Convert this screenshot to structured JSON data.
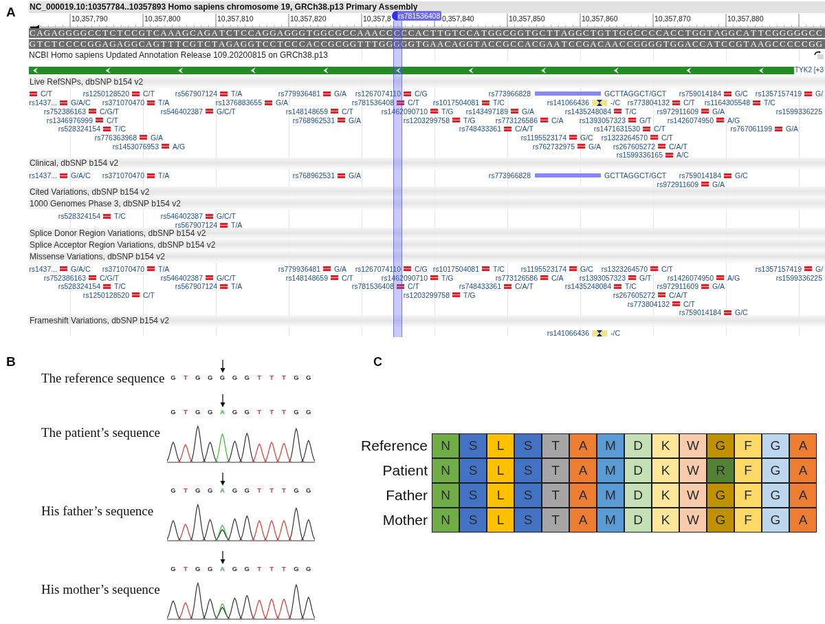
{
  "panel_a": {
    "panel_label": "A",
    "title": "NC_000019.10:10357784..10357893 Homo sapiens chromosome 19, GRCh38.p13 Primary Assembly",
    "ruler": {
      "ticks": [
        "10,357,790",
        "10,357,800",
        "10,357,810",
        "10,357,820",
        "10,357,8",
        "0,357,840",
        "10,357,850",
        "10,357,860",
        "10,357,870",
        "10,357,880"
      ]
    },
    "selection": {
      "label": "rs781536408"
    },
    "sequence": {
      "forward": "CAGAGGGGCCTCTCCGTCAAAGCAGATCTCCAGGAGGGTGGCGCCAAACCCCCACTTGTCCATGGCGGTGCTTAGGCTGTTGGCCCCACCTGGTAGGCATTCGGGGGCC",
      "reverse": "GTCTCCCCGGAGAGGCAGTTTCGTCTAGAGGTCCTCCCACCGCGGTTTGGGGGTGAACAGGTACCGCCACGAATCCGACAACCGGGGTGGACCATCCGTAAGCCCCCGG"
    },
    "annotation_release": "NCBI Homo sapiens Updated Annotation Release 109.20200815 on GRCh38.p13",
    "gene": {
      "label": "TYK2 [+3",
      "reverse_strand": true
    },
    "tracks": [
      {
        "title": "Live RefSNPs, dbSNP b154 v2",
        "rows": [
          {
            "variants": [
              {
                "kind": "snv",
                "allele": "C/T"
              },
              {
                "name": "rs1250128520",
                "kind": "snv",
                "allele": "C/T"
              },
              {
                "name": "rs567907124",
                "kind": "snv",
                "allele": "T/A"
              },
              {
                "name": "rs779936481",
                "kind": "snv",
                "allele": "G/A"
              },
              {
                "name": "rs1267074110",
                "kind": "snv",
                "allele": "C/G"
              },
              {
                "name": "rs773966828",
                "kind": "mnv",
                "allele": "GCTTAGGCT/GCT"
              },
              {
                "name": "rs759014184",
                "kind": "snv",
                "allele": "G/C"
              },
              {
                "name": "rs1357157419",
                "kind": "snv",
                "allele": "G/"
              }
            ]
          },
          {
            "variants": [
              {
                "name": "rs1437...",
                "kind": "snv",
                "allele": "G/A/C"
              },
              {
                "name": "rs371070470",
                "kind": "snv",
                "allele": "T/A"
              },
              {
                "name": "rs1376883655",
                "kind": "snv",
                "allele": "G/A"
              },
              {
                "name": "rs781536408",
                "kind": "snv",
                "allele": "C/T"
              },
              {
                "name": "rs1017504081",
                "kind": "snv",
                "allele": "T/C"
              },
              {
                "name": "rs141066436",
                "kind": "insertion",
                "allele": "-/C"
              },
              {
                "name": "rs773804132",
                "kind": "snv",
                "allele": "C/T"
              },
              {
                "name": "rs1164305548",
                "kind": "snv",
                "allele": "T/C"
              }
            ]
          },
          {
            "variants": [
              {
                "name": "rs752386163",
                "kind": "snv",
                "allele": "C/G/T"
              },
              {
                "name": "rs546402387",
                "kind": "snv",
                "allele": "G/C/T"
              },
              {
                "name": "rs148148659",
                "kind": "snv",
                "allele": "C/T"
              },
              {
                "name": "rs1462090710",
                "kind": "snv",
                "allele": "T/G"
              },
              {
                "name": "rs143497189",
                "kind": "snv",
                "allele": "G/A"
              },
              {
                "name": "rs1435248084",
                "kind": "snv",
                "allele": "T/C"
              },
              {
                "name": "rs972911609",
                "kind": "snv",
                "allele": "G/A"
              },
              {
                "name": "rs1599336225"
              }
            ]
          },
          {
            "variants": [
              {
                "name": "rs1346976999",
                "kind": "snv",
                "allele": "C/T"
              },
              {
                "name": "rs768962531",
                "kind": "snv",
                "allele": "G/A"
              },
              {
                "name": "rs1203299758",
                "kind": "snv",
                "allele": "T/G"
              },
              {
                "name": "rs773126586",
                "kind": "snv",
                "allele": "C/A"
              },
              {
                "name": "rs1393057323",
                "kind": "snv",
                "allele": "G/T"
              },
              {
                "name": "rs1426074950",
                "kind": "snv",
                "allele": "A/G"
              }
            ]
          },
          {
            "variants": [
              {
                "name": "rs528324154",
                "kind": "snv",
                "allele": "T/C"
              },
              {
                "name": "rs748433361",
                "kind": "snv",
                "allele": "C/A/T"
              },
              {
                "name": "rs1471631530",
                "kind": "snv",
                "allele": "C/T"
              },
              {
                "name": "rs767061199",
                "kind": "snv",
                "allele": "G/A"
              }
            ]
          },
          {
            "variants": [
              {
                "name": "rs776363968",
                "kind": "snv",
                "allele": "G/A"
              },
              {
                "name": "rs1195523174",
                "kind": "snv",
                "allele": "G/C"
              },
              {
                "name": "rs1323264570",
                "kind": "snv",
                "allele": "C/T"
              }
            ]
          },
          {
            "variants": [
              {
                "name": "rs1453076953",
                "kind": "snv",
                "allele": "A/G"
              },
              {
                "name": "rs762732975",
                "kind": "snv",
                "allele": "G/A"
              },
              {
                "name": "rs267605272",
                "kind": "snv",
                "allele": "C/A/T"
              }
            ]
          },
          {
            "variants": [
              {
                "name": "rs1599336165",
                "kind": "snv",
                "allele": "A/C"
              }
            ]
          }
        ]
      },
      {
        "title": "Clinical, dbSNP b154 v2",
        "rows": [
          {
            "variants": [
              {
                "name": "rs1437...",
                "kind": "snv",
                "allele": "G/A/C"
              },
              {
                "name": "rs371070470",
                "kind": "snv",
                "allele": "T/A"
              },
              {
                "name": "rs768962531",
                "kind": "snv",
                "allele": "G/A"
              },
              {
                "name": "rs773966828",
                "kind": "mnv",
                "allele": "GCTTAGGCT/GCT"
              },
              {
                "name": "rs759014184",
                "kind": "snv",
                "allele": "G/C"
              }
            ]
          },
          {
            "variants": [
              {
                "name": "rs972911609",
                "kind": "snv",
                "allele": "G/A"
              }
            ]
          }
        ]
      },
      {
        "title": "Cited Variations, dbSNP b154 v2"
      },
      {
        "title": "1000 Genomes Phase 3, dbSNP b154 v2",
        "rows": [
          {
            "variants": [
              {
                "name": "rs528324154",
                "kind": "snv",
                "allele": "T/C"
              },
              {
                "name": "rs546402387",
                "kind": "snv",
                "allele": "G/C/T"
              }
            ]
          },
          {
            "variants": [
              {
                "name": "rs567907124",
                "kind": "snv",
                "allele": "T/A"
              }
            ]
          }
        ]
      },
      {
        "title": "Splice Donor Region Variations, dbSNP b154 v2"
      },
      {
        "title": "Splice Acceptor Region Variations, dbSNP b154 v2"
      },
      {
        "title": "Missense Variations, dbSNP b154 v2",
        "rows": [
          {
            "variants": [
              {
                "name": "rs1437...",
                "kind": "snv",
                "allele": "G/A/C"
              },
              {
                "name": "rs371070470",
                "kind": "snv",
                "allele": "T/A"
              },
              {
                "name": "rs779936481",
                "kind": "snv",
                "allele": "G/A"
              },
              {
                "name": "rs1267074110",
                "kind": "snv",
                "allele": "C/G"
              },
              {
                "name": "rs1017504081",
                "kind": "snv",
                "allele": "T/C"
              },
              {
                "name": "rs1195523174",
                "kind": "snv",
                "allele": "G/C"
              },
              {
                "name": "rs1323264570",
                "kind": "snv",
                "allele": "C/T"
              },
              {
                "name": "rs1357157419",
                "kind": "snv",
                "allele": "G/"
              }
            ]
          },
          {
            "variants": [
              {
                "name": "rs752386163",
                "kind": "snv",
                "allele": "C/G/T"
              },
              {
                "name": "rs546402387",
                "kind": "snv",
                "allele": "G/C/T"
              },
              {
                "name": "rs148148659",
                "kind": "snv",
                "allele": "C/T"
              },
              {
                "name": "rs1462090710",
                "kind": "snv",
                "allele": "T/G"
              },
              {
                "name": "rs773126586",
                "kind": "snv",
                "allele": "C/A"
              },
              {
                "name": "rs1393057323",
                "kind": "snv",
                "allele": "G/T"
              },
              {
                "name": "rs1426074950",
                "kind": "snv",
                "allele": "A/G"
              },
              {
                "name": "rs1599336225"
              }
            ]
          },
          {
            "variants": [
              {
                "name": "rs528324154",
                "kind": "snv",
                "allele": "T/C"
              },
              {
                "name": "rs567907124",
                "kind": "snv",
                "allele": "T/A"
              },
              {
                "name": "rs781536408",
                "kind": "snv",
                "allele": "C/T"
              },
              {
                "name": "rs748433361",
                "kind": "snv",
                "allele": "C/A/T"
              },
              {
                "name": "rs1435248084",
                "kind": "snv",
                "allele": "T/C"
              },
              {
                "name": "rs972911609",
                "kind": "snv",
                "allele": "G/A"
              }
            ]
          },
          {
            "variants": [
              {
                "name": "rs1250128520",
                "kind": "snv",
                "allele": "C/T"
              },
              {
                "name": "rs1203299758",
                "kind": "snv",
                "allele": "T/G"
              },
              {
                "name": "rs267605272",
                "kind": "snv",
                "allele": "C/A/T"
              }
            ]
          },
          {
            "variants": [
              {
                "name": "rs773804132",
                "kind": "snv",
                "allele": "C/T"
              }
            ]
          },
          {
            "variants": [
              {
                "name": "rs759014184",
                "kind": "snv",
                "allele": "G/C"
              }
            ]
          }
        ]
      },
      {
        "title": "Frameshift Variations, dbSNP b154 v2",
        "rows": [
          {
            "variants": [
              {
                "name": "rs141066436",
                "kind": "insertion",
                "allele": "-/C"
              }
            ]
          }
        ]
      }
    ]
  },
  "panel_b": {
    "panel_label": "B",
    "sequences": [
      {
        "label": "The reference sequence",
        "kind": "reference",
        "bases": [
          {
            "base": "G",
            "color": "#333333",
            "marked": false
          },
          {
            "base": "T",
            "color": "#e8322a",
            "marked": false
          },
          {
            "base": "G",
            "color": "#333333",
            "marked": false
          },
          {
            "base": "G",
            "color": "#333333",
            "marked": false
          },
          {
            "base": "G",
            "color": "#333333",
            "marked": true
          },
          {
            "base": "G",
            "color": "#333333",
            "marked": false
          },
          {
            "base": "G",
            "color": "#333333",
            "marked": false
          },
          {
            "base": "T",
            "color": "#e8322a",
            "marked": false
          },
          {
            "base": "T",
            "color": "#e8322a",
            "marked": false
          },
          {
            "base": "T",
            "color": "#e8322a",
            "marked": false
          },
          {
            "base": "G",
            "color": "#333333",
            "marked": false
          },
          {
            "base": "G",
            "color": "#333333",
            "marked": false
          }
        ]
      },
      {
        "label": "The patient’s sequence",
        "kind": "chromatogram",
        "bases": [
          {
            "base": "G",
            "color": "#333333",
            "marked": false
          },
          {
            "base": "T",
            "color": "#e8322a",
            "marked": false
          },
          {
            "base": "G",
            "color": "#333333",
            "marked": false
          },
          {
            "base": "G",
            "color": "#333333",
            "marked": false
          },
          {
            "base": "A",
            "color": "#2fbf2f",
            "marked": true
          },
          {
            "base": "G",
            "color": "#333333",
            "marked": false
          },
          {
            "base": "G",
            "color": "#333333",
            "marked": false
          },
          {
            "base": "T",
            "color": "#e8322a",
            "marked": false
          },
          {
            "base": "T",
            "color": "#e8322a",
            "marked": false
          },
          {
            "base": "T",
            "color": "#e8322a",
            "marked": false
          },
          {
            "base": "G",
            "color": "#333333",
            "marked": false
          },
          {
            "base": "G",
            "color": "#333333",
            "marked": false
          }
        ]
      },
      {
        "label": "His father’s sequence",
        "kind": "chromatogram",
        "bases": [
          {
            "base": "G",
            "color": "#333333",
            "marked": false
          },
          {
            "base": "T",
            "color": "#e8322a",
            "marked": false
          },
          {
            "base": "G",
            "color": "#333333",
            "marked": false
          },
          {
            "base": "G",
            "color": "#333333",
            "marked": false
          },
          {
            "base": "A",
            "color": "#2fbf2f",
            "marked": true
          },
          {
            "base": "G",
            "color": "#333333",
            "marked": false
          },
          {
            "base": "G",
            "color": "#333333",
            "marked": false
          },
          {
            "base": "T",
            "color": "#e8322a",
            "marked": false
          },
          {
            "base": "T",
            "color": "#e8322a",
            "marked": false
          },
          {
            "base": "T",
            "color": "#e8322a",
            "marked": false
          },
          {
            "base": "G",
            "color": "#333333",
            "marked": false
          },
          {
            "base": "G",
            "color": "#333333",
            "marked": false
          }
        ]
      },
      {
        "label": "His mother’s sequence",
        "kind": "chromatogram",
        "bases": [
          {
            "base": "G",
            "color": "#333333",
            "marked": false
          },
          {
            "base": "T",
            "color": "#e8322a",
            "marked": false
          },
          {
            "base": "G",
            "color": "#333333",
            "marked": false
          },
          {
            "base": "G",
            "color": "#333333",
            "marked": false
          },
          {
            "base": "A",
            "color": "#2fbf2f",
            "marked": true
          },
          {
            "base": "G",
            "color": "#333333",
            "marked": false
          },
          {
            "base": "G",
            "color": "#333333",
            "marked": false
          },
          {
            "base": "T",
            "color": "#e8322a",
            "marked": false
          },
          {
            "base": "T",
            "color": "#e8322a",
            "marked": false
          },
          {
            "base": "T",
            "color": "#e8322a",
            "marked": false
          },
          {
            "base": "G",
            "color": "#333333",
            "marked": false
          },
          {
            "base": "G",
            "color": "#333333",
            "marked": false
          }
        ]
      }
    ]
  },
  "panel_c": {
    "panel_label": "C",
    "rows": [
      {
        "label": "Reference",
        "residues": [
          {
            "residue": "N",
            "color": "#70ad47"
          },
          {
            "residue": "S",
            "color": "#4472c4"
          },
          {
            "residue": "L",
            "color": "#ffc000"
          },
          {
            "residue": "S",
            "color": "#4472c4"
          },
          {
            "residue": "T",
            "color": "#a5a5a5"
          },
          {
            "residue": "A",
            "color": "#ed7d31"
          },
          {
            "residue": "M",
            "color": "#5b9bd5"
          },
          {
            "residue": "D",
            "color": "#c5e0b4"
          },
          {
            "residue": "K",
            "color": "#ffe699"
          },
          {
            "residue": "W",
            "color": "#f8cbad"
          },
          {
            "residue": "G",
            "color": "#bf9000"
          },
          {
            "residue": "F",
            "color": "#ffd966"
          },
          {
            "residue": "G",
            "color": "#bdd7ee"
          },
          {
            "residue": "A",
            "color": "#ed7d31"
          }
        ]
      },
      {
        "label": "Patient",
        "residues": [
          {
            "residue": "N",
            "color": "#70ad47"
          },
          {
            "residue": "S",
            "color": "#4472c4"
          },
          {
            "residue": "L",
            "color": "#ffc000"
          },
          {
            "residue": "S",
            "color": "#4472c4"
          },
          {
            "residue": "T",
            "color": "#a5a5a5"
          },
          {
            "residue": "A",
            "color": "#ed7d31"
          },
          {
            "residue": "M",
            "color": "#5b9bd5"
          },
          {
            "residue": "D",
            "color": "#c5e0b4"
          },
          {
            "residue": "K",
            "color": "#ffe699"
          },
          {
            "residue": "W",
            "color": "#f8cbad"
          },
          {
            "residue": "R",
            "color": "#548235"
          },
          {
            "residue": "F",
            "color": "#ffd966"
          },
          {
            "residue": "G",
            "color": "#bdd7ee"
          },
          {
            "residue": "A",
            "color": "#ed7d31"
          }
        ]
      },
      {
        "label": "Father",
        "residues": [
          {
            "residue": "N",
            "color": "#70ad47"
          },
          {
            "residue": "S",
            "color": "#4472c4"
          },
          {
            "residue": "L",
            "color": "#ffc000"
          },
          {
            "residue": "S",
            "color": "#4472c4"
          },
          {
            "residue": "T",
            "color": "#a5a5a5"
          },
          {
            "residue": "A",
            "color": "#ed7d31"
          },
          {
            "residue": "M",
            "color": "#5b9bd5"
          },
          {
            "residue": "D",
            "color": "#c5e0b4"
          },
          {
            "residue": "K",
            "color": "#ffe699"
          },
          {
            "residue": "W",
            "color": "#f8cbad"
          },
          {
            "residue": "G",
            "color": "#bf9000"
          },
          {
            "residue": "F",
            "color": "#ffd966"
          },
          {
            "residue": "G",
            "color": "#bdd7ee"
          },
          {
            "residue": "A",
            "color": "#ed7d31"
          }
        ]
      },
      {
        "label": "Mother",
        "residues": [
          {
            "residue": "N",
            "color": "#70ad47"
          },
          {
            "residue": "S",
            "color": "#4472c4"
          },
          {
            "residue": "L",
            "color": "#ffc000"
          },
          {
            "residue": "S",
            "color": "#4472c4"
          },
          {
            "residue": "T",
            "color": "#a5a5a5"
          },
          {
            "residue": "A",
            "color": "#ed7d31"
          },
          {
            "residue": "M",
            "color": "#5b9bd5"
          },
          {
            "residue": "D",
            "color": "#c5e0b4"
          },
          {
            "residue": "K",
            "color": "#ffe699"
          },
          {
            "residue": "W",
            "color": "#f8cbad"
          },
          {
            "residue": "G",
            "color": "#bf9000"
          },
          {
            "residue": "F",
            "color": "#ffd966"
          },
          {
            "residue": "G",
            "color": "#bdd7ee"
          },
          {
            "residue": "A",
            "color": "#ed7d31"
          }
        ]
      }
    ]
  }
}
